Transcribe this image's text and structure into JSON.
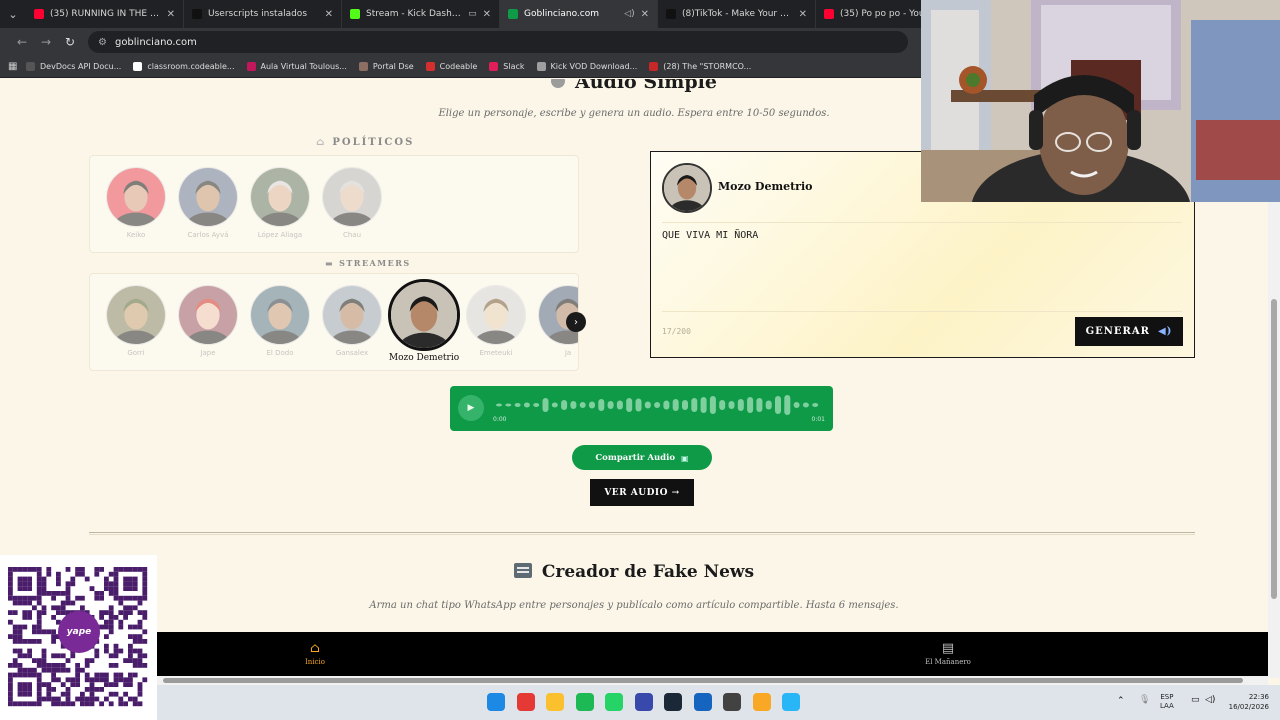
{
  "browser": {
    "tabs": [
      {
        "title": "(35) RUNNING IN THE 90'S - Yo",
        "color": "#ff0033",
        "active": false,
        "muted": false
      },
      {
        "title": "Userscripts instalados",
        "color": "#111111",
        "active": false,
        "muted": false
      },
      {
        "title": "Stream - Kick Dashboard",
        "color": "#53fc18",
        "active": false,
        "muted": false,
        "badge": true
      },
      {
        "title": "Goblinciano.com",
        "color": "#0f9a48",
        "active": true,
        "muted": true
      },
      {
        "title": "(8)TikTok - Make Your Day",
        "color": "#111111",
        "active": false,
        "muted": false
      },
      {
        "title": "(35) Po po po - YouTube",
        "color": "#ff0033",
        "active": false,
        "muted": false
      }
    ],
    "url": "goblinciano.com",
    "bookmarks": [
      {
        "label": "DevDocs API Docu...",
        "color": "#555555"
      },
      {
        "label": "classroom.codeable...",
        "color": "#ffffff"
      },
      {
        "label": "Aula Virtual Toulous...",
        "color": "#c2185b"
      },
      {
        "label": "Portal Dse",
        "color": "#8d6e63"
      },
      {
        "label": "Codeable",
        "color": "#d32f2f"
      },
      {
        "label": "Slack",
        "color": "#e01e5a"
      },
      {
        "label": "Kick VOD Download...",
        "color": "#9e9e9e"
      },
      {
        "label": "(28) The \"STORMCO...",
        "color": "#c62828"
      }
    ]
  },
  "audio_section": {
    "title": "Audio Simple",
    "subtitle": "Elige un personaje, escribe y genera un audio. Espera entre 10-50 segundos.",
    "politicos_label": "POLÍTICOS",
    "politicos": [
      {
        "name": "Keiko",
        "skin": "#d9a38c",
        "hair": "#1a1a1a",
        "bg": "#e94b5a"
      },
      {
        "name": "Carlos Ayvá",
        "skin": "#c99a7a",
        "hair": "#2b2b2b",
        "bg": "#6d7c99"
      },
      {
        "name": "López Aliaga",
        "skin": "#e0b8a0",
        "hair": "#d8d8d8",
        "bg": "#6b7d6a"
      },
      {
        "name": "Chau",
        "skin": "#e2c4b0",
        "hair": "#d0d0d0",
        "bg": "#b9b9b9"
      }
    ],
    "streamers_label": "STREAMERS",
    "streamers": [
      {
        "name": "Gorri",
        "skin": "#c9a27c",
        "hair": "#5a6b3a",
        "bg": "#8a8a6a"
      },
      {
        "name": "Jape",
        "skin": "#f0c8b6",
        "hair": "#d2342a",
        "bg": "#9c5a6b"
      },
      {
        "name": "El Dodo",
        "skin": "#c8a080",
        "hair": "#2e3b4a",
        "bg": "#5f7d8c"
      },
      {
        "name": "Gansalex",
        "skin": "#b88c6e",
        "hair": "#1a1a1a",
        "bg": "#9aa8b8"
      },
      {
        "name": "Mozo Demetrio",
        "skin": "#b58869",
        "hair": "#1a1a1a",
        "bg": "#c9c2b6",
        "selected": true
      },
      {
        "name": "Emeteuki",
        "skin": "#e8d2b8",
        "hair": "#7a5a3a",
        "bg": "#d6d6d6"
      },
      {
        "name": "Ja",
        "skin": "#b08a70",
        "hair": "#1a1a1a",
        "bg": "#5a6a88"
      }
    ],
    "editor": {
      "character": "Mozo Demetrio",
      "text": "QUE VIVA MI ÑORA",
      "counter": "17/200",
      "generate_label": "GENERAR",
      "generate_icon": "speaker-icon"
    },
    "player": {
      "time_current": "0:00",
      "time_total": "0:01",
      "color": "#0f9a48"
    },
    "share_label": "Compartir Audio",
    "view_label": "VER AUDIO →"
  },
  "fake_news": {
    "title": "Creador de Fake News",
    "subtitle": "Arma un chat tipo WhatsApp entre personajes y publícalo como artículo compartible. Hasta 6 mensajes."
  },
  "bottom_nav": {
    "home_label": "Inicio",
    "news_label": "El Mañanero",
    "active_color": "#f5a623"
  },
  "taskbar": {
    "lang_top": "ESP",
    "lang_bottom": "LAA",
    "time": "22:36",
    "date": "16/02/2026",
    "apps": [
      {
        "name": "windows-start-icon",
        "color": "#1e88e5"
      },
      {
        "name": "chrome-icon",
        "color": "#e53935"
      },
      {
        "name": "file-explorer-icon",
        "color": "#fbc02d"
      },
      {
        "name": "spotify-icon",
        "color": "#1db954"
      },
      {
        "name": "whatsapp-icon",
        "color": "#25d366"
      },
      {
        "name": "photos-icon",
        "color": "#3949ab"
      },
      {
        "name": "steam-icon",
        "color": "#1b2838"
      },
      {
        "name": "app-blue-icon",
        "color": "#1565c0"
      },
      {
        "name": "obs-icon",
        "color": "#424242"
      },
      {
        "name": "app-yellow-icon",
        "color": "#f9a825"
      },
      {
        "name": "app-lightblue-icon",
        "color": "#29b6f6"
      }
    ]
  },
  "overlays": {
    "qr_brand": "yape"
  }
}
